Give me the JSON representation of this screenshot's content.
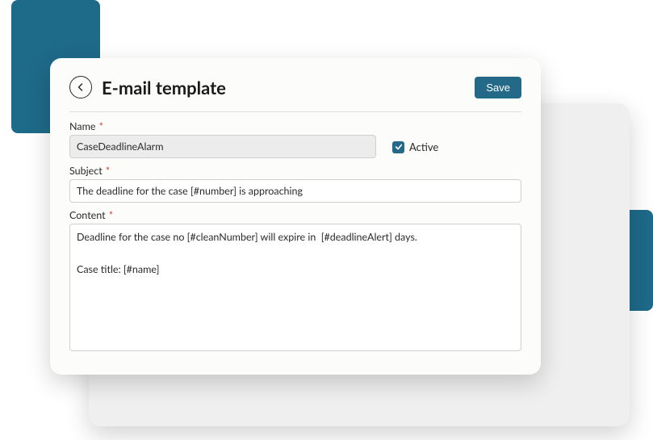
{
  "header": {
    "title": "E-mail template",
    "save_label": "Save"
  },
  "form": {
    "name": {
      "label": "Name",
      "value": "CaseDeadlineAlarm"
    },
    "active": {
      "label": "Active",
      "checked": true
    },
    "subject": {
      "label": "Subject",
      "value": "The deadline for the case [#number] is approaching"
    },
    "content": {
      "label": "Content",
      "value": "Deadline for the case no [#cleanNumber] will expire in  [#deadlineAlert] days.\n\nCase title: [#name]"
    }
  }
}
